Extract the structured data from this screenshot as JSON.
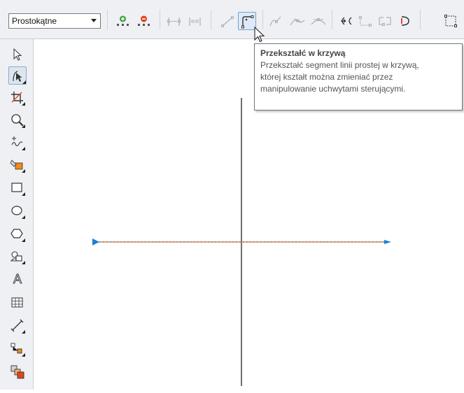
{
  "propertybar": {
    "mode_select": {
      "value": "Prostokątne"
    },
    "buttons": [
      {
        "icon": "add-node-icon"
      },
      {
        "icon": "delete-node-icon"
      },
      {
        "icon": "join-nodes-icon"
      },
      {
        "icon": "break-curve-icon"
      },
      {
        "icon": "convert-to-line-icon"
      },
      {
        "icon": "convert-to-curve-icon",
        "active": true
      },
      {
        "icon": "cusp-node-icon"
      },
      {
        "icon": "smooth-node-icon"
      },
      {
        "icon": "symmetrical-node-icon"
      },
      {
        "icon": "reverse-direction-icon"
      },
      {
        "icon": "extend-curve-to-close-icon"
      },
      {
        "icon": "extract-subpath-icon"
      },
      {
        "icon": "close-curve-icon"
      },
      {
        "icon": "stretch-scale-nodes-icon"
      }
    ]
  },
  "toolbox": {
    "tools": [
      {
        "icon": "pick-tool-icon"
      },
      {
        "icon": "shape-tool-icon",
        "active": true
      },
      {
        "icon": "crop-tool-icon"
      },
      {
        "icon": "zoom-tool-icon"
      },
      {
        "icon": "freehand-tool-icon"
      },
      {
        "icon": "smart-fill-tool-icon"
      },
      {
        "icon": "rectangle-tool-icon"
      },
      {
        "icon": "ellipse-tool-icon"
      },
      {
        "icon": "polygon-tool-icon"
      },
      {
        "icon": "basic-shapes-tool-icon"
      },
      {
        "icon": "text-tool-icon",
        "label": "A"
      },
      {
        "icon": "table-tool-icon"
      },
      {
        "icon": "dimension-tool-icon"
      },
      {
        "icon": "connector-tool-icon"
      },
      {
        "icon": "interactive-fill-tool-icon"
      }
    ]
  },
  "tooltip": {
    "title": "Przekształć w krzywą",
    "lines": [
      "Przekształć segment linii prostej w krzywą,",
      "której kształt można zmieniać przez",
      "manipulowanie uchwytami sterującymi."
    ]
  },
  "colors": {
    "chrome_bg": "#eef0f3",
    "selected_line": "#e06b2a",
    "node_marker": "#1d7fd6",
    "accent_orange": "#f08a18"
  }
}
